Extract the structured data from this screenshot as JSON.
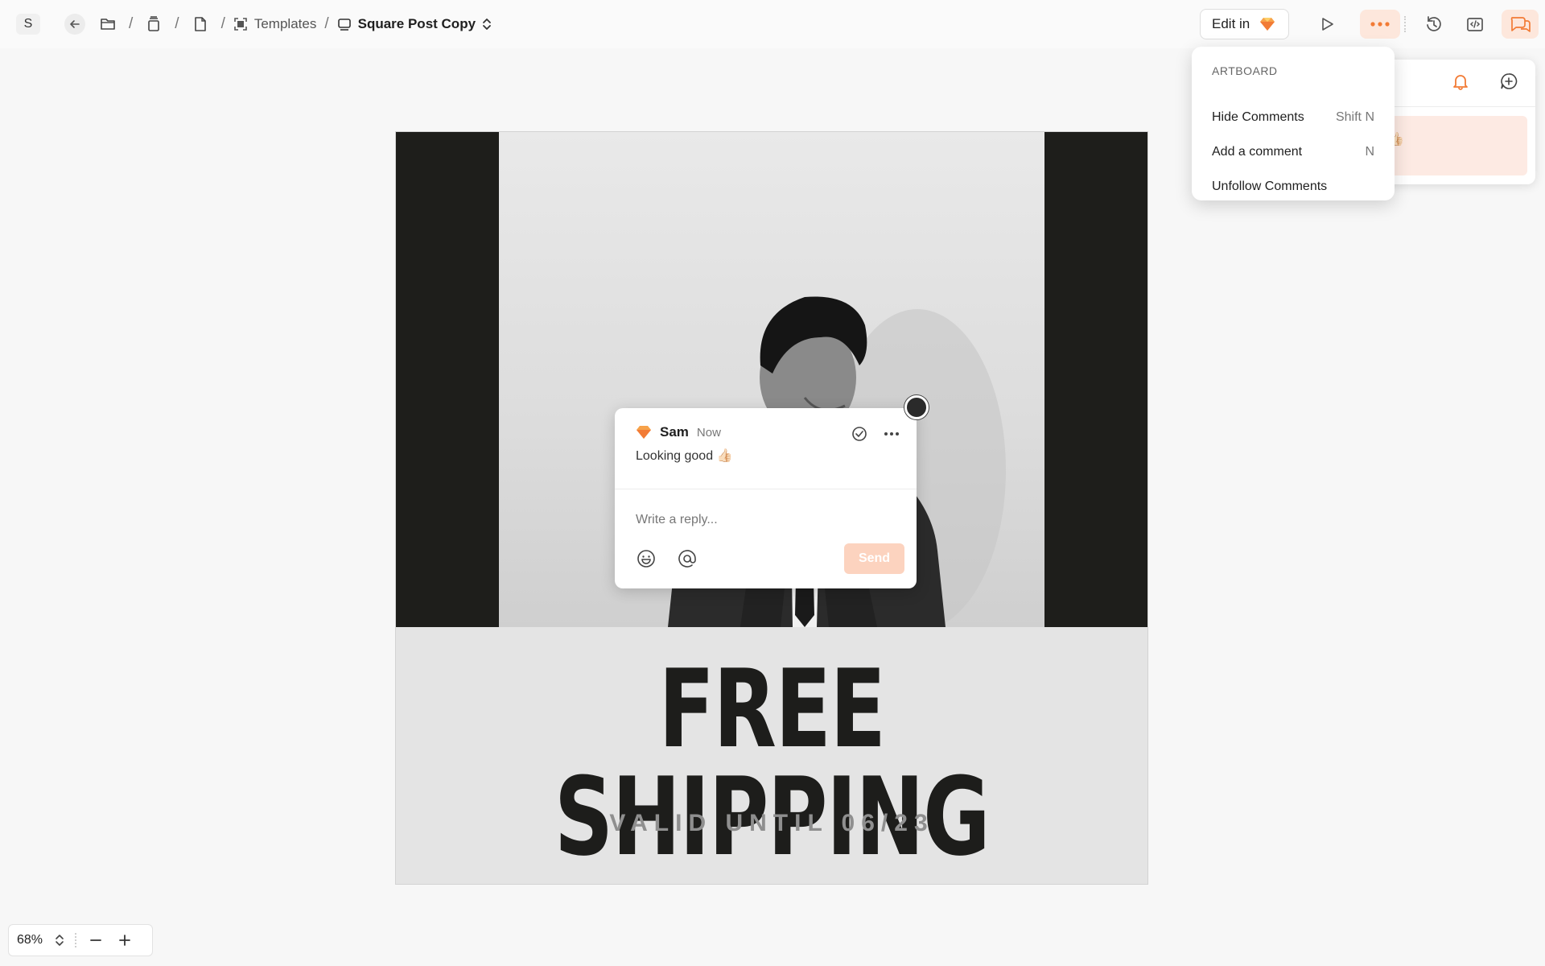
{
  "topbar": {
    "workspace_initial": "S",
    "breadcrumb": {
      "templates_label": "Templates",
      "current_label": "Square Post Copy",
      "separator": "/"
    },
    "edit_in_label": "Edit in"
  },
  "artboard": {
    "headline": "FREE SHIPPING",
    "subline": "VALID UNTIL 06/23"
  },
  "comment": {
    "author": "Sam",
    "time": "Now",
    "body": "Looking good 👍🏻",
    "reply_placeholder": "Write a reply...",
    "send_label": "Send"
  },
  "side_panel": {
    "item_text": "d 👍🏻"
  },
  "menu": {
    "header": "ARTBOARD",
    "items": [
      {
        "label": "Hide Comments",
        "shortcut": "Shift N"
      },
      {
        "label": "Add a comment",
        "shortcut": "N"
      },
      {
        "label": "Unfollow Comments",
        "shortcut": ""
      }
    ]
  },
  "zoom": {
    "value": "68%"
  },
  "colors": {
    "accent": "#f27b35",
    "accent_soft": "#fde7dc",
    "artboard_dark": "#1e1e1b"
  },
  "icons": [
    "back-arrow-icon",
    "folder-icon",
    "project-icon",
    "document-icon",
    "artboard-icon",
    "frame-icon",
    "chevron-updown-icon",
    "sketch-diamond-icon",
    "play-icon",
    "more-icon",
    "history-icon",
    "inspect-icon",
    "comments-icon",
    "bell-icon",
    "add-comment-icon",
    "resolve-icon",
    "emoji-icon",
    "mention-icon",
    "minus-icon",
    "plus-icon"
  ]
}
